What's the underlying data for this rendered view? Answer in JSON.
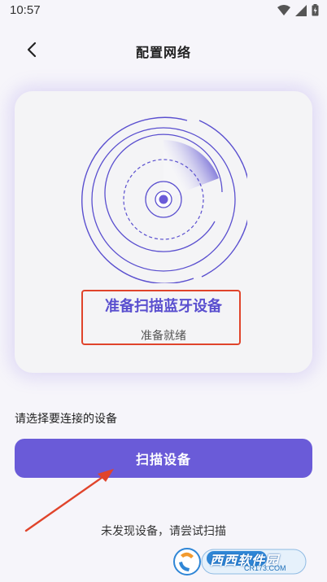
{
  "status_bar": {
    "time": "10:57",
    "icons": [
      "wifi-icon",
      "signal-icon",
      "battery-charging-icon"
    ]
  },
  "nav": {
    "title": "配置网络",
    "back_icon": "chevron-left-icon"
  },
  "scan_card": {
    "title": "准备扫描蓝牙设备",
    "status": "准备就绪"
  },
  "section_label": "请选择要连接的设备",
  "scan_button_label": "扫描设备",
  "hint": "未发现设备，请尝试扫描",
  "watermark": {
    "main": "西西软件园",
    "sub": "CR173.COM"
  },
  "colors": {
    "accent": "#6a5bd8",
    "annotation": "#e0442b",
    "background": "#f6f5fa",
    "card": "#f4f4f6"
  }
}
